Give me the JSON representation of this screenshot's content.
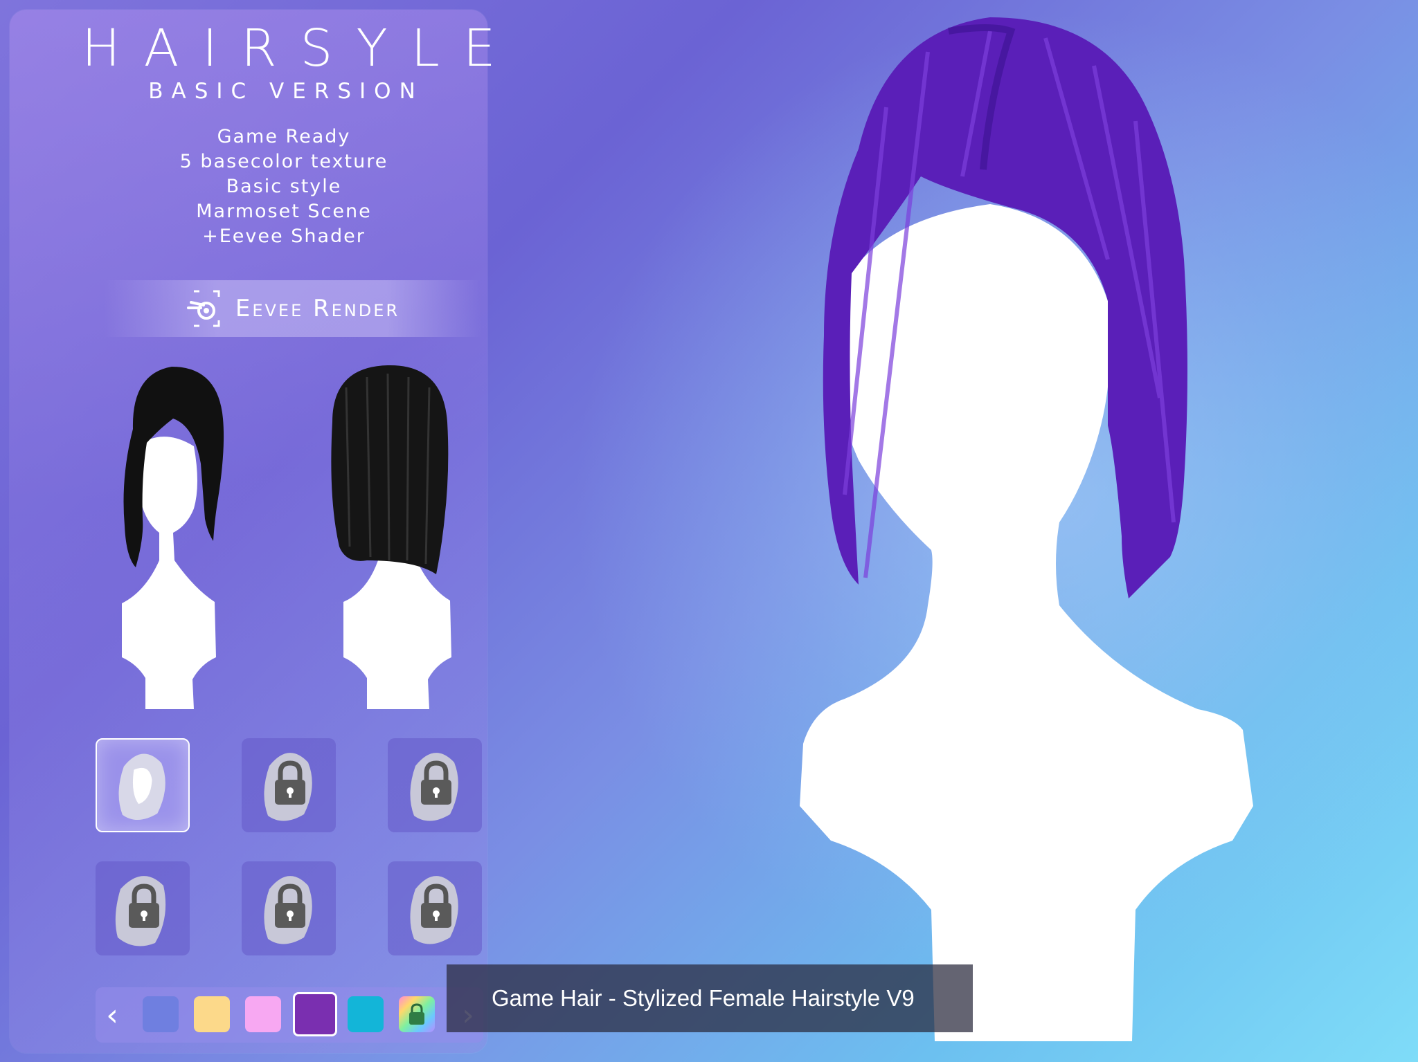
{
  "header": {
    "title": "HAIRSYLE",
    "subtitle": "BASIC VERSION"
  },
  "features": [
    "Game Ready",
    "5 basecolor texture",
    "Basic style",
    "Marmoset Scene",
    "+Eevee Shader"
  ],
  "render_banner": {
    "icon": "blender-icon",
    "label": "Eevee Render"
  },
  "previews": [
    {
      "view": "front",
      "hair_color": "#111111"
    },
    {
      "view": "back",
      "hair_color": "#111111"
    }
  ],
  "style_grid": {
    "selected_index": 0,
    "slots": [
      {
        "locked": false
      },
      {
        "locked": true
      },
      {
        "locked": true
      },
      {
        "locked": true
      },
      {
        "locked": true
      },
      {
        "locked": true
      }
    ]
  },
  "color_bar": {
    "prev_icon": "chevron-left-icon",
    "next_icon": "chevron-right-icon",
    "selected_index": 3,
    "swatches": [
      "#6f7fe0",
      "#fcd98a",
      "#f7a8f2",
      "#7a2fb0",
      "#13b5d8",
      "rainbow-lock"
    ]
  },
  "main_hair_color": "#5a1fb8",
  "caption": {
    "text": "Game Hair - Stylized Female Hairstyle V9"
  }
}
